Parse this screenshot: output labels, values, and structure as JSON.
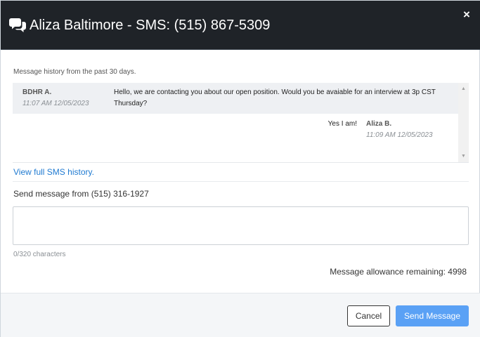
{
  "header": {
    "title": "Aliza Baltimore - SMS: (515) 867-5309",
    "icon": "comments-icon",
    "close_label": "×"
  },
  "history": {
    "caption": "Message history from the past 30 days.",
    "messages": [
      {
        "sender": "BDHR A.",
        "time": "11:07 AM 12/05/2023",
        "text": "Hello, we are contacting you about our open position. Would you be avaiable for an interview at 3p CST Thursday?"
      },
      {
        "sender": "Aliza B.",
        "time": "11:09 AM 12/05/2023",
        "text": "Yes I am!"
      }
    ],
    "full_history_link": "View full SMS history."
  },
  "compose": {
    "send_from": "Send message from (515) 316-1927",
    "value": "",
    "char_count": "0/320 characters",
    "allowance": "Message allowance remaining: 4998"
  },
  "footer": {
    "cancel_label": "Cancel",
    "send_label": "Send Message"
  },
  "colors": {
    "header_bg": "#1f2328",
    "accent": "#5aa1f5",
    "link": "#1f7ad1"
  }
}
